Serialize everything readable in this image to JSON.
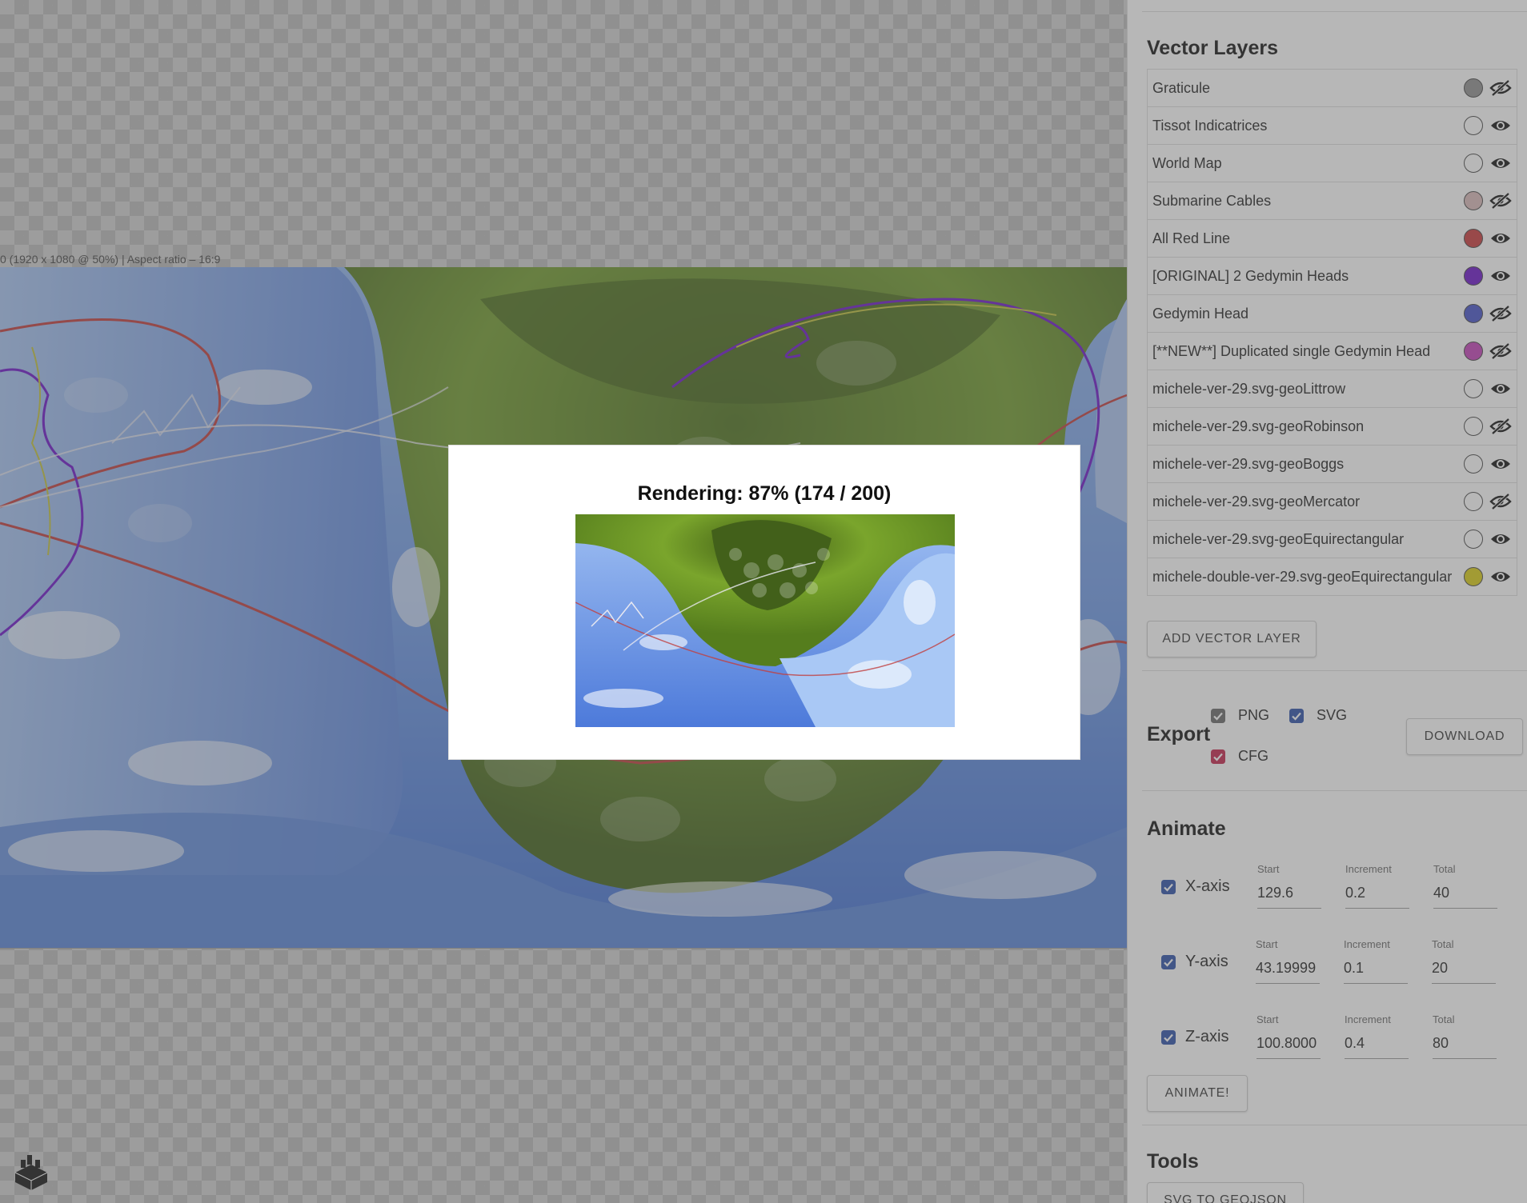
{
  "canvas": {
    "info": "0 (1920 x 1080 @ 50%) | Aspect ratio – 16:9"
  },
  "modal": {
    "title": "Rendering: 87% (174 / 200)",
    "progress": 0.87,
    "done": 174,
    "total": 200
  },
  "vector_layers": {
    "title": "Vector Layers",
    "add_button": "ADD VECTOR LAYER",
    "items": [
      {
        "name": "Graticule",
        "color": "#8f8f8f",
        "visible": false
      },
      {
        "name": "Tissot Indicatrices",
        "color": "#ffffff",
        "visible": true
      },
      {
        "name": "World Map",
        "color": "#ffffff",
        "visible": true
      },
      {
        "name": "Submarine Cables",
        "color": "#d9b8b8",
        "visible": false
      },
      {
        "name": "All Red Line",
        "color": "#c9383a",
        "visible": true
      },
      {
        "name": "[ORIGINAL] 2 Gedymin Heads",
        "color": "#6a12c9",
        "visible": true
      },
      {
        "name": "Gedymin Head",
        "color": "#4451c9",
        "visible": false
      },
      {
        "name": "[**NEW**] Duplicated single Gedymin Head",
        "color": "#c43fb8",
        "visible": false
      },
      {
        "name": "michele-ver-29.svg-geoLittrow",
        "color": "#ffffff",
        "visible": true
      },
      {
        "name": "michele-ver-29.svg-geoRobinson",
        "color": "#ffffff",
        "visible": false
      },
      {
        "name": "michele-ver-29.svg-geoBoggs",
        "color": "#ffffff",
        "visible": true
      },
      {
        "name": "michele-ver-29.svg-geoMercator",
        "color": "#ffffff",
        "visible": false
      },
      {
        "name": "michele-ver-29.svg-geoEquirectangular",
        "color": "#ffffff",
        "visible": true
      },
      {
        "name": "michele-double-ver-29.svg-geoEquirectangular",
        "color": "#d9cc12",
        "visible": true
      }
    ]
  },
  "export": {
    "title": "Export",
    "png": {
      "label": "PNG",
      "checked": true,
      "color": "#666666"
    },
    "svg": {
      "label": "SVG",
      "checked": true,
      "color": "#2a4fa8"
    },
    "cfg": {
      "label": "CFG",
      "checked": true,
      "color": "#c4224a"
    },
    "download_button": "DOWNLOAD"
  },
  "animate": {
    "title": "Animate",
    "axes": [
      {
        "label": "X-axis",
        "checked": true,
        "start_label": "Start",
        "start": "129.6",
        "increment_label": "Increment",
        "increment": "0.2",
        "total_label": "Total",
        "total": "40"
      },
      {
        "label": "Y-axis",
        "checked": true,
        "start_label": "Start",
        "start": "43.19999",
        "increment_label": "Increment",
        "increment": "0.1",
        "total_label": "Total",
        "total": "20"
      },
      {
        "label": "Z-axis",
        "checked": true,
        "start_label": "Start",
        "start": "100.8000",
        "increment_label": "Increment",
        "increment": "0.4",
        "total_label": "Total",
        "total": "80"
      }
    ],
    "animate_button": "ANIMATE!"
  },
  "tools": {
    "title": "Tools",
    "svg_to_geojson_button": "SVG TO GEOJSON"
  },
  "icons": {
    "eye_open": "eye-icon",
    "eye_closed": "eye-off-icon",
    "logo": "blocks-logo-icon"
  }
}
